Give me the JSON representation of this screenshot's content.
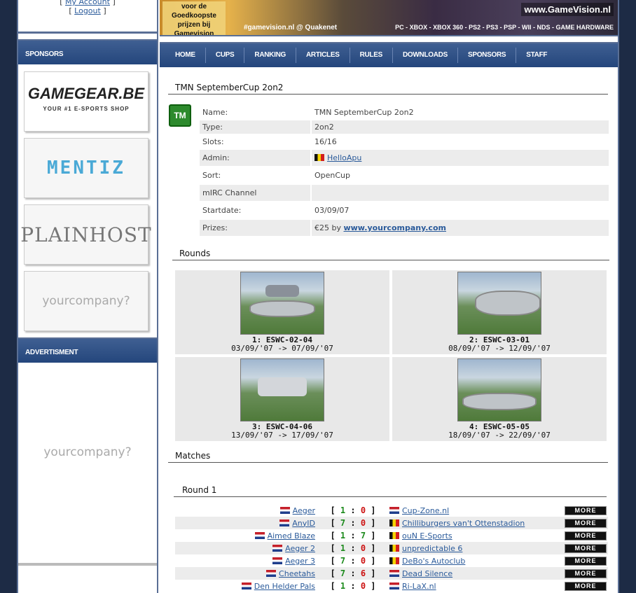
{
  "account": {
    "my_account": "My Account",
    "logout": "Logout"
  },
  "banner": {
    "promo": "voor de Goedkoopste prijzen bij Gamevision",
    "irc": "#gamevision.nl @ Quakenet",
    "site": "www.GameVision.nl",
    "platforms": "PC - XBOX - XBOX 360 - PS2 - PS3 - PSP - WII - NDS - GAME HARDWARE"
  },
  "sidebar": {
    "sponsors_header": "SPONSORS",
    "sponsors": {
      "gamegear_logo": "GAMEGEAR.BE",
      "gamegear_tag": "YOUR #1 E-SPORTS SHOP",
      "mentiz": "MENTIZ",
      "plainhost": "PLAINHOST",
      "yourcompany": "yourcompany?"
    },
    "advertisment_header": "ADVERTISMENT",
    "ad_text": "yourcompany?"
  },
  "nav": [
    "HOME",
    "CUPS",
    "RANKING",
    "ARTICLES",
    "RULES",
    "DOWNLOADS",
    "SPONSORS",
    "STAFF"
  ],
  "cup": {
    "title": "TMN SeptemberCup 2on2",
    "icon_label": "TM",
    "fields": [
      {
        "key": "Name:",
        "value": "TMN SeptemberCup 2on2"
      },
      {
        "key": "Type:",
        "value": "2on2"
      },
      {
        "key": "Slots:",
        "value": "16/16"
      },
      {
        "key": "Admin:",
        "value": "HelloApu"
      },
      {
        "key": "Sort:",
        "value": "OpenCup"
      },
      {
        "key": "mIRC Channel",
        "value": ""
      },
      {
        "key": "Startdate:",
        "value": "03/09/07"
      },
      {
        "key": "Prizes:",
        "value_prefix": "€25 by ",
        "value_link": "www.yourcompany.com"
      }
    ]
  },
  "rounds": {
    "title": "Rounds",
    "items": [
      {
        "name": "1: ESWC-02-04",
        "dates": "03/09/'07 -> 07/09/'07"
      },
      {
        "name": "2: ESWC-03-01",
        "dates": "08/09/'07 -> 12/09/'07"
      },
      {
        "name": "3: ESWC-04-06",
        "dates": "13/09/'07 -> 17/09/'07"
      },
      {
        "name": "4: ESWC-05-05",
        "dates": "18/09/'07 -> 22/09/'07"
      }
    ]
  },
  "matches": {
    "title": "Matches",
    "round1_title": "Round 1",
    "more_label": "MORE",
    "rows": [
      {
        "team1": "Aeger",
        "flag1": "nl",
        "s1": "1",
        "s2": "0",
        "team2": "Cup-Zone.nl",
        "flag2": "nl"
      },
      {
        "team1": "AnyID",
        "flag1": "nl",
        "s1": "7",
        "s2": "0",
        "team2": "Chilliburgers van't Ottenstadion",
        "flag2": "be"
      },
      {
        "team1": "Aimed Blaze",
        "flag1": "nl",
        "s1": "1",
        "s2": "7",
        "team2": "ouN E-Sports",
        "flag2": "be"
      },
      {
        "team1": "Aeger 2",
        "flag1": "nl",
        "s1": "1",
        "s2": "0",
        "team2": "unpredictable 6",
        "flag2": "be"
      },
      {
        "team1": "Aeger 3",
        "flag1": "nl",
        "s1": "7",
        "s2": "0",
        "team2": "DeBo's Autoclub",
        "flag2": "be"
      },
      {
        "team1": "Cheetahs",
        "flag1": "nl",
        "s1": "7",
        "s2": "6",
        "team2": "Dead Silence",
        "flag2": "nl"
      },
      {
        "team1": "Den Helder Pals",
        "flag1": "nl",
        "s1": "1",
        "s2": "0",
        "team2": "Ri-LaX.nl",
        "flag2": "nl"
      }
    ]
  },
  "colors": {
    "header_blue": "#24467c",
    "frame_bg": "#1d2b45",
    "score_green": "#1c8a1c",
    "score_red": "#cc1111",
    "link": "#2a5a9a"
  }
}
